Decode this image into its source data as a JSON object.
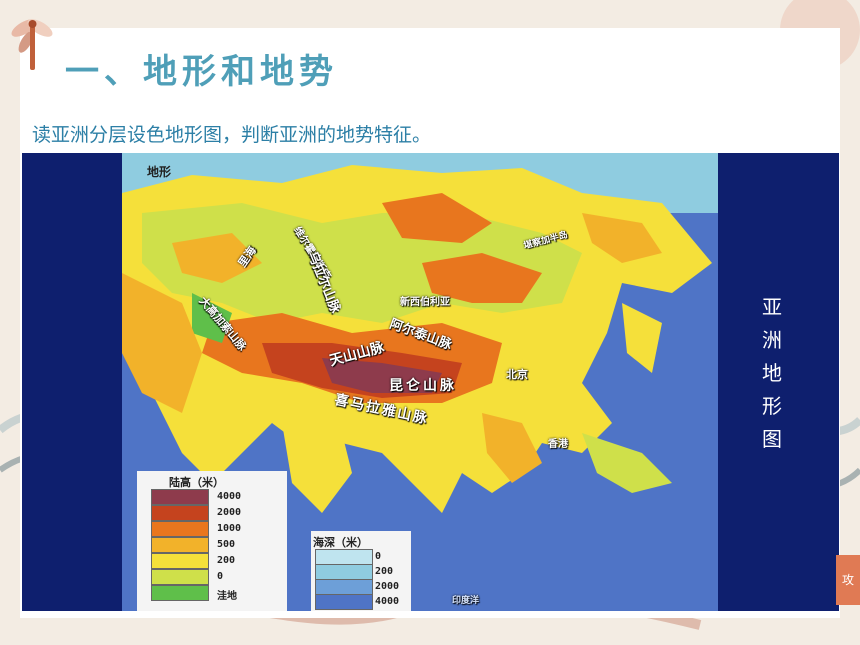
{
  "slide": {
    "title": "一、地形和地势",
    "instruction": "读亚洲分层设色地形图，判断亚洲的地势特征。"
  },
  "map": {
    "vertical_title": [
      "亚",
      "洲",
      "地",
      "形",
      "图"
    ],
    "corner_label": "地形",
    "labels": {
      "verkhoyansk": "维尔霍扬斯克",
      "ural": "乌拉尔山脉",
      "caspian": "里海",
      "caucasus": "大高加索山脉",
      "siberia": "新西伯利亚",
      "altai": "阿尔泰山脉",
      "kamchatka": "堪察加半岛",
      "tianshan": "天山山脉",
      "kunlun": "昆仑山脉",
      "himalaya": "喜马拉雅山脉",
      "beijing": "北京",
      "hongkong": "香港",
      "indian_ocean": "印度洋"
    },
    "land_legend": {
      "title": "陆高（米）",
      "items": [
        {
          "label": "4000",
          "color": "#8e3b4c"
        },
        {
          "label": "2000",
          "color": "#c5431e"
        },
        {
          "label": "1000",
          "color": "#e8761e"
        },
        {
          "label": "500",
          "color": "#f2b22a"
        },
        {
          "label": "200",
          "color": "#f5e03a"
        },
        {
          "label": "0",
          "color": "#cfe04a"
        },
        {
          "label": "洼地",
          "color": "#5fbf4a"
        }
      ]
    },
    "sea_legend": {
      "title": "海深（米）",
      "items": [
        {
          "label": "0",
          "color": "#bfe4ef"
        },
        {
          "label": "200",
          "color": "#8fcce0"
        },
        {
          "label": "2000",
          "color": "#6d9fd8"
        },
        {
          "label": "4000",
          "color": "#4f74c6"
        }
      ]
    },
    "corner_stamp": "攻"
  },
  "colors": {
    "title": "#4f9fb8",
    "instruction": "#2c7fa6",
    "map_frame": "#0e1f6e"
  }
}
